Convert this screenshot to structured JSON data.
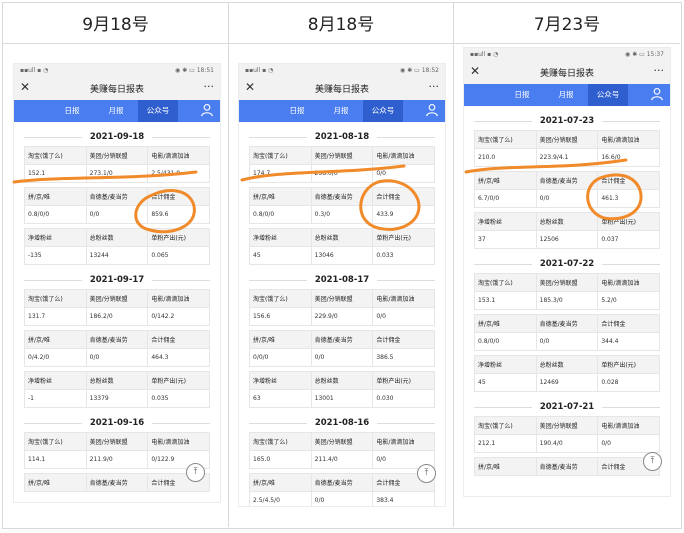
{
  "columns": [
    {
      "header": "9月18号",
      "statusbar": {
        "left": "▪︎▪︎ull ▪︎ ◔",
        "right": "◉ ✱ ▭ 18:51"
      },
      "sections": [
        {
          "date": "2021-09-18",
          "headers": [
            "淘宝(饿了么)",
            "美团/分销联盟",
            "电影/滴滴加油",
            "拼/京/唯",
            "肯德基/麦当劳",
            "合计佣金",
            "净增粉丝",
            "总粉丝数",
            "单粉产出(元)"
          ],
          "values": [
            "152.1",
            "273.1/0",
            "2.5/431.0",
            "0.8/0/0",
            "0/0",
            "859.6",
            "-135",
            "13244",
            "0.065"
          ]
        },
        {
          "date": "2021-09-17",
          "headers": [
            "淘宝(饿了么)",
            "美团/分销联盟",
            "电影/滴滴加油",
            "拼/京/唯",
            "肯德基/麦当劳",
            "合计佣金",
            "净增粉丝",
            "总粉丝数",
            "单粉产出(元)"
          ],
          "values": [
            "131.7",
            "186.2/0",
            "0/142.2",
            "0/4.2/0",
            "0/0",
            "464.3",
            "-1",
            "13379",
            "0.035"
          ]
        },
        {
          "date": "2021-09-16",
          "headers": [
            "淘宝(饿了么)",
            "美团/分销联盟",
            "电影/滴滴加油",
            "拼/京/唯",
            "肯德基/麦当劳",
            "合计佣金"
          ],
          "values": [
            "114.1",
            "211.9/0",
            "0/122.9"
          ]
        }
      ]
    },
    {
      "header": "8月18号",
      "statusbar": {
        "left": "▪︎▪︎ull ▪︎ ◔",
        "right": "◉ ✱ ▭ 18:52"
      },
      "sections": [
        {
          "date": "2021-08-18",
          "headers": [
            "淘宝(饿了么)",
            "美团/分销联盟",
            "电影/滴滴加油",
            "拼/京/唯",
            "肯德基/麦当劳",
            "合计佣金",
            "净增粉丝",
            "总粉丝数",
            "单粉产出(元)"
          ],
          "values": [
            "174.7",
            "258.0/0",
            "0/0",
            "0.8/0/0",
            "0.3/0",
            "433.9",
            "45",
            "13046",
            "0.033"
          ]
        },
        {
          "date": "2021-08-17",
          "headers": [
            "淘宝(饿了么)",
            "美团/分销联盟",
            "电影/滴滴加油",
            "拼/京/唯",
            "肯德基/麦当劳",
            "合计佣金",
            "净增粉丝",
            "总粉丝数",
            "单粉产出(元)"
          ],
          "values": [
            "156.6",
            "229.9/0",
            "0/0",
            "0/0/0",
            "0/0",
            "386.5",
            "63",
            "13001",
            "0.030"
          ]
        },
        {
          "date": "2021-08-16",
          "headers": [
            "淘宝(饿了么)",
            "美团/分销联盟",
            "电影/滴滴加油",
            "拼/京/唯",
            "肯德基/麦当劳",
            "合计佣金"
          ],
          "values": [
            "165.0",
            "211.4/0",
            "0/0",
            "2.5/4.5/0",
            "0/0",
            "383.4"
          ]
        }
      ]
    },
    {
      "header": "7月23号",
      "statusbar": {
        "left": "▪︎▪︎ull ▪︎ ◔",
        "right": "◉ ✱ ▭ 15:37"
      },
      "sections": [
        {
          "date": "2021-07-23",
          "headers": [
            "淘宝(饿了么)",
            "美团/分销联盟",
            "电影/滴滴加油",
            "拼/京/唯",
            "肯德基/麦当劳",
            "合计佣金",
            "净增粉丝",
            "总粉丝数",
            "单粉产出(元)"
          ],
          "values": [
            "210.0",
            "223.9/4.1",
            "16.6/0",
            "6.7/0/0",
            "0/0",
            "461.3",
            "37",
            "12506",
            "0.037"
          ]
        },
        {
          "date": "2021-07-22",
          "headers": [
            "淘宝(饿了么)",
            "美团/分销联盟",
            "电影/滴滴加油",
            "拼/京/唯",
            "肯德基/麦当劳",
            "合计佣金",
            "净增粉丝",
            "总粉丝数",
            "单粉产出(元)"
          ],
          "values": [
            "153.1",
            "185.3/0",
            "5.2/0",
            "0.8/0/0",
            "0/0",
            "344.4",
            "45",
            "12469",
            "0.028"
          ]
        },
        {
          "date": "2021-07-21",
          "headers": [
            "淘宝(饿了么)",
            "美团/分销联盟",
            "电影/滴滴加油",
            "拼/京/唯",
            "肯德基/麦当劳",
            "合计佣金"
          ],
          "values": [
            "212.1",
            "190.4/0",
            "0/0"
          ]
        }
      ]
    }
  ],
  "app": {
    "title": "美赚每日报表",
    "close_icon": "✕",
    "more_icon": "···",
    "tabs": [
      "日报",
      "月报",
      "公众号"
    ],
    "active_tab": "公众号",
    "scroll_top_icon": "⤒"
  },
  "colors": {
    "tab_bar": "#4a7ef0",
    "tab_active": "#2f5fcf",
    "ink": "#f08a2a"
  }
}
